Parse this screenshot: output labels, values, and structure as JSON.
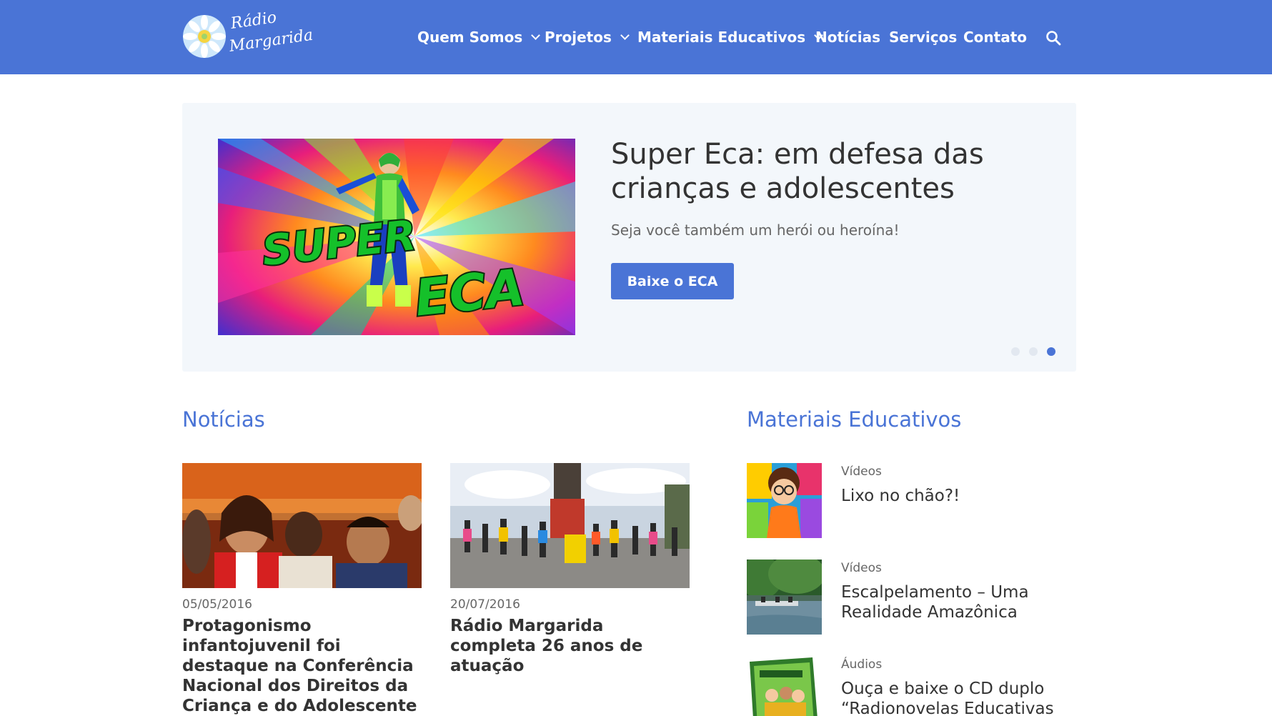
{
  "header": {
    "logo": {
      "line1": "Rádio",
      "line2": "Margarida"
    },
    "nav": [
      {
        "label": "Quem Somos",
        "dropdown": true
      },
      {
        "label": "Projetos",
        "dropdown": true
      },
      {
        "label": "Materiais Educativos",
        "dropdown": true
      },
      {
        "label": "Notícias",
        "dropdown": false
      },
      {
        "label": "Serviços",
        "dropdown": false
      },
      {
        "label": "Contato",
        "dropdown": false
      }
    ],
    "search_icon": "search-icon"
  },
  "hero": {
    "image_text_1": "SUPER",
    "image_text_2": "ECA",
    "title": "Super Eca: em defesa das crianças e adolescentes",
    "subtitle": "Seja você também um herói ou heroína!",
    "button_label": "Baixe o ECA",
    "slides_count": 3,
    "active_slide": 3
  },
  "news": {
    "heading": "Notícias",
    "items": [
      {
        "date": "05/05/2016",
        "title": "Protagonismo infantojuvenil foi destaque na Conferência Nacional dos Direitos da Criança e do Adolescente"
      },
      {
        "date": "20/07/2016",
        "title": "Rádio Margarida completa 26 anos de atuação"
      }
    ]
  },
  "materials": {
    "heading": "Materiais Educativos",
    "items": [
      {
        "category": "Vídeos",
        "title": "Lixo no chão?!"
      },
      {
        "category": "Vídeos",
        "title": "Escalpelamento – Uma Realidade Amazônica"
      },
      {
        "category": "Áudios",
        "title": "Ouça e baixe o CD duplo “Radionovelas Educativas –"
      }
    ]
  },
  "colors": {
    "brand_blue": "#4a74d6",
    "hero_bg": "#f3f7fb",
    "text_dark": "#333333",
    "text_muted": "#666666"
  }
}
